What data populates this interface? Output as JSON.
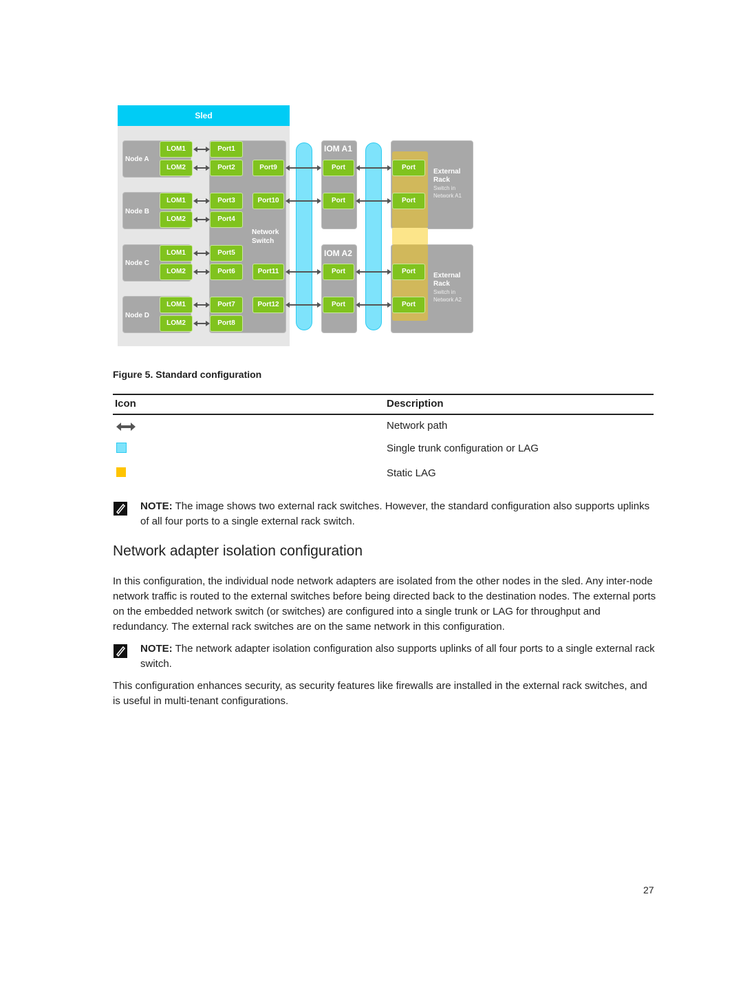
{
  "diagram": {
    "sled_title": "Sled",
    "nodes": [
      {
        "label": "Node A",
        "loms": [
          "LOM1",
          "LOM2"
        ],
        "ports": [
          "Port1",
          "Port2"
        ]
      },
      {
        "label": "Node B",
        "loms": [
          "LOM1",
          "LOM2"
        ],
        "ports": [
          "Port3",
          "Port4"
        ]
      },
      {
        "label": "Node C",
        "loms": [
          "LOM1",
          "LOM2"
        ],
        "ports": [
          "Port5",
          "Port6"
        ]
      },
      {
        "label": "Node D",
        "loms": [
          "LOM1",
          "LOM2"
        ],
        "ports": [
          "Port7",
          "Port8"
        ]
      }
    ],
    "switch_label": [
      "Network",
      "Switch"
    ],
    "uplink_ports": [
      "Port9",
      "Port10",
      "Port11",
      "Port12"
    ],
    "iom": [
      {
        "label": "IOM A1",
        "ports": [
          "Port",
          "Port"
        ]
      },
      {
        "label": "IOM A2",
        "ports": [
          "Port",
          "Port"
        ]
      }
    ],
    "external": [
      {
        "title": [
          "External",
          "Rack"
        ],
        "subtitle": [
          "Switch in",
          "Network A1"
        ],
        "ports": [
          "Port",
          "Port"
        ]
      },
      {
        "title": [
          "External",
          "Rack"
        ],
        "subtitle": [
          "Switch in",
          "Network A2"
        ],
        "ports": [
          "Port",
          "Port"
        ]
      }
    ],
    "colors": {
      "sled_header": "#00ccf5",
      "port_green": "#80c31e",
      "box_gray": "#a8a8a8",
      "trunk_blue": "#7ee3fb",
      "lag_yellow": "#f2c41c"
    }
  },
  "caption": "Figure 5. Standard configuration",
  "legend_table": {
    "headers": [
      "Icon",
      "Description"
    ],
    "rows": [
      {
        "icon": "double-arrow-icon",
        "description": "Network path"
      },
      {
        "icon": "blue-square-icon",
        "description": "Single trunk configuration or LAG"
      },
      {
        "icon": "yellow-square-icon",
        "description": "Static LAG"
      }
    ]
  },
  "note1": {
    "label": "NOTE:",
    "text": " The image shows two external rack switches. However, the standard configuration also supports uplinks of all four ports to a single external rack switch."
  },
  "section_title": "Network adapter isolation configuration",
  "para1": "In this configuration, the individual node network adapters are isolated from the other nodes in the sled. Any inter-node network traffic is routed to the external switches before being directed back to the destination nodes. The external ports on the embedded network switch (or switches) are configured into a single trunk or LAG for throughput and redundancy. The external rack switches are on the same network in this configuration.",
  "note2": {
    "label": "NOTE:",
    "text": " The network adapter isolation configuration also supports uplinks of all four ports to a single external rack switch."
  },
  "para2": "This configuration enhances security, as security features like firewalls are installed in the external rack switches, and is useful in multi-tenant configurations.",
  "page_number": "27"
}
